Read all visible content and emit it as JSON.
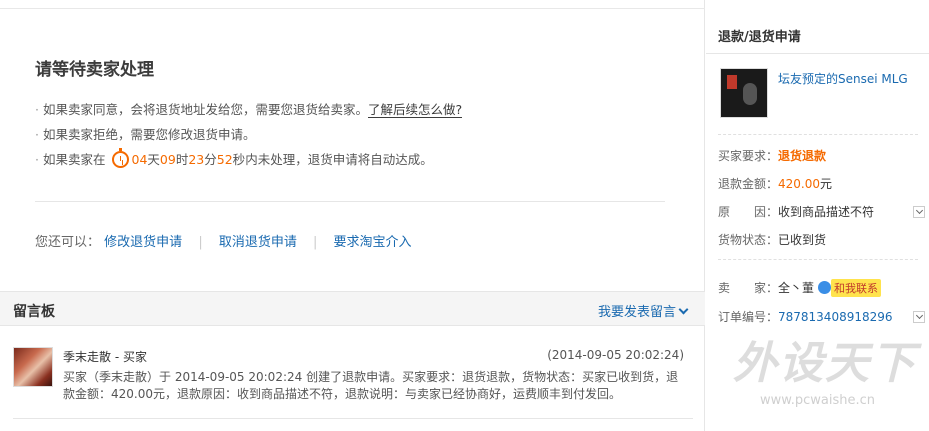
{
  "main": {
    "title": "请等待卖家处理",
    "bullet1": "如果卖家同意，会将退货地址发给您，需要您退货给卖家。",
    "bullet1_link": "了解后续怎么做?",
    "bullet2": "如果卖家拒绝，需要您修改退货申请。",
    "bullet3_prefix": "如果卖家在",
    "countdown": {
      "days": "04",
      "hours": "09",
      "minutes": "23",
      "seconds": "52"
    },
    "unit_day": "天",
    "unit_hour": "时",
    "unit_min": "分",
    "unit_sec": "秒",
    "bullet3_suffix": "内未处理，退货申请将自动达成。",
    "actions_label": "您还可以：",
    "action_modify": "修改退货申请",
    "action_cancel": "取消退货申请",
    "action_intervene": "要求淘宝介入",
    "separator": "|"
  },
  "message_board": {
    "title": "留言板",
    "post_label": "我要发表留言",
    "message": {
      "author": "季末走散 - 买家",
      "time": "(2014-09-05 20:02:24)",
      "body": "买家（季末走散）于 2014-09-05 20:02:24 创建了退款申请。买家要求：退货退款，货物状态：买家已收到货，退款金额：420.00元，退款原因：收到商品描述不符，退款说明：与卖家已经协商好，运费顺丰到付发回。"
    }
  },
  "side": {
    "title": "退款/退货申请",
    "item_title": "坛友预定的Sensei MLG",
    "rows": {
      "request_label": "买家要求：",
      "request_value": "退货退款",
      "amount_label": "退款金额：",
      "amount_value": "420.00",
      "amount_unit": "元",
      "reason_label": "原　　因：",
      "reason_value": "收到商品描述不符",
      "status_label": "货物状态：",
      "status_value": "已收到货",
      "seller_label": "卖　　家：",
      "seller_value": "全丶董",
      "contact_label": "和我联系",
      "order_label": "订单编号：",
      "order_value": "787813408918296"
    }
  },
  "watermark": {
    "brand": "外设天下",
    "url": "www.pcwaishe.cn"
  }
}
